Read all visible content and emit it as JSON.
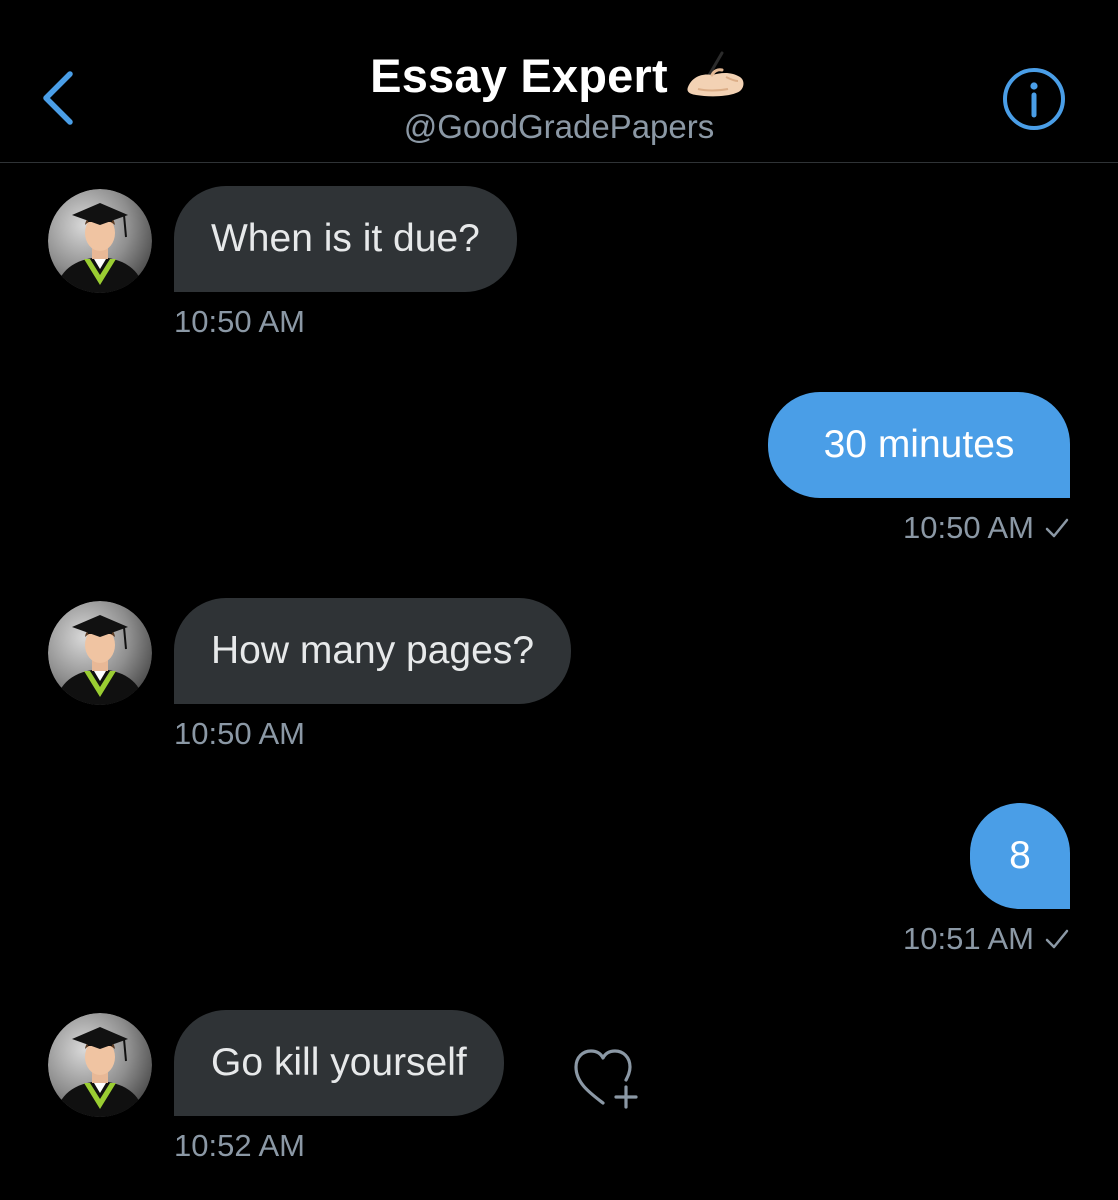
{
  "header": {
    "title": "Essay Expert",
    "title_emoji": "writing-hand-emoji",
    "handle": "@GoodGradePapers",
    "back_icon": "chevron-left-icon",
    "info_icon": "info-circle-icon"
  },
  "colors": {
    "background": "#000000",
    "accent": "#4a9ee7",
    "received_bubble": "#2f3336",
    "secondary_text": "#8b98a5"
  },
  "messages": [
    {
      "direction": "received",
      "text": "When is it due?",
      "time": "10:50 AM"
    },
    {
      "direction": "sent",
      "text": "30 minutes",
      "time": "10:50 AM",
      "status_icon": "checkmark-icon"
    },
    {
      "direction": "received",
      "text": "How many pages?",
      "time": "10:50 AM"
    },
    {
      "direction": "sent",
      "text": "8",
      "time": "10:51 AM",
      "status_icon": "checkmark-icon"
    },
    {
      "direction": "received",
      "text": "Go kill yourself",
      "time": "10:52 AM",
      "reaction_icon": "heart-plus-icon"
    }
  ]
}
